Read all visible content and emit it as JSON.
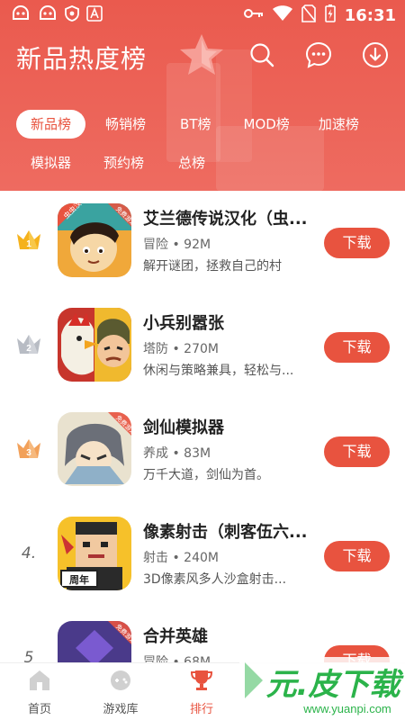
{
  "status_bar": {
    "time": "16:31",
    "left_icons": [
      "bug-icon",
      "bug-icon",
      "shield-icon",
      "a-icon"
    ],
    "right_icons": [
      "key-icon",
      "wifi-icon",
      "no-sim-icon",
      "battery-charging-icon"
    ]
  },
  "header": {
    "title": "新品热度榜",
    "actions": [
      "search-icon",
      "message-icon",
      "download-icon"
    ],
    "tabs_row1": [
      {
        "label": "新品榜",
        "active": true
      },
      {
        "label": "畅销榜",
        "active": false
      },
      {
        "label": "BT榜",
        "active": false
      },
      {
        "label": "MOD榜",
        "active": false
      },
      {
        "label": "加速榜",
        "active": false
      }
    ],
    "tabs_row2": [
      {
        "label": "模拟器",
        "active": false
      },
      {
        "label": "预约榜",
        "active": false
      },
      {
        "label": "总榜",
        "active": false
      }
    ]
  },
  "list": {
    "download_label": "下载",
    "items": [
      {
        "rank": "1",
        "rank_style": "gold-crown",
        "name": "艾兰德传说汉化（虫...",
        "meta": "冒险 • 92M",
        "desc": "解开谜团，拯救自己的村",
        "icon_badge": "虫虫汉化",
        "icon_tag": "免费游戏"
      },
      {
        "rank": "2",
        "rank_style": "silver-crown",
        "name": "小兵别嚣张",
        "meta": "塔防 • 270M",
        "desc": "休闲与策略兼具，轻松与...",
        "icon_badge": "",
        "icon_tag": ""
      },
      {
        "rank": "3",
        "rank_style": "bronze-crown",
        "name": "剑仙模拟器",
        "meta": "养成 • 83M",
        "desc": "万千大道，剑仙为首。",
        "icon_badge": "",
        "icon_tag": "免费游戏"
      },
      {
        "rank": "4.",
        "rank_style": "number",
        "name": "像素射击（刺客伍六...",
        "meta": "射击 • 240M",
        "desc": "3D像素风多人沙盒射击...",
        "icon_badge": "周年",
        "icon_tag": ""
      },
      {
        "rank": "5",
        "rank_style": "number",
        "name": "合并英雄",
        "meta": "冒险 • 68M",
        "desc": "",
        "icon_badge": "",
        "icon_tag": "免费游戏"
      }
    ]
  },
  "bottom_nav": [
    {
      "label": "首页",
      "icon": "home-icon",
      "active": false
    },
    {
      "label": "游戏库",
      "icon": "gamepad-icon",
      "active": false
    },
    {
      "label": "排行",
      "icon": "trophy-icon",
      "active": true
    }
  ],
  "watermark": {
    "text": "元.皮下载",
    "url": "www.yuanpi.com"
  },
  "colors": {
    "accent": "#e8533f",
    "header_bg": "#ec6156",
    "gold": "#f5b21d",
    "silver": "#b8bcc4",
    "bronze": "#f2a15a"
  }
}
